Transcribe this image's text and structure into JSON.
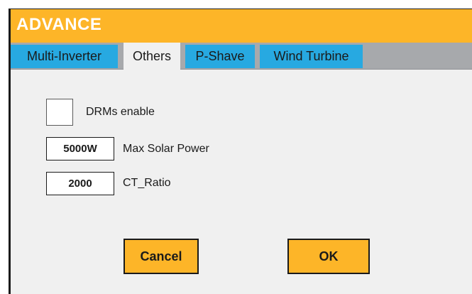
{
  "window": {
    "title": "ADVANCE"
  },
  "tabs": [
    {
      "label": "Multi-Inverter",
      "active": false
    },
    {
      "label": "Others",
      "active": true
    },
    {
      "label": "P-Shave",
      "active": false
    },
    {
      "label": "Wind Turbine",
      "active": false
    }
  ],
  "settings": {
    "drm": {
      "label": "DRMs enable",
      "checked": false
    },
    "max_solar_power": {
      "label": "Max Solar Power",
      "value": "5000W"
    },
    "ct_ratio": {
      "label": "CT_Ratio",
      "value": "2000"
    }
  },
  "buttons": {
    "cancel": "Cancel",
    "ok": "OK"
  },
  "colors": {
    "accent": "#fdb528",
    "tab": "#27a9e1",
    "tab_bar": "#a7a9ac",
    "panel": "#f0f0f0"
  }
}
